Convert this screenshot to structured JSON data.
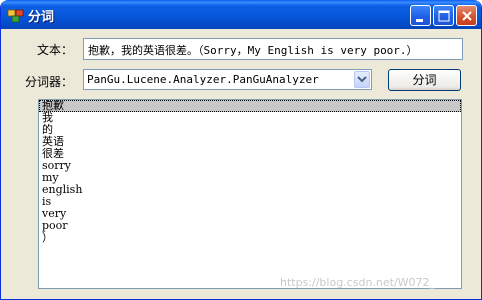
{
  "window": {
    "title": "分词"
  },
  "form": {
    "text_label": "文本：",
    "text_value": "抱歉，我的英语很差。（Sorry，My English is very poor.）",
    "segmenter_label": "分词器：",
    "segmenter_value": "PanGu.Lucene.Analyzer.PanGuAnalyzer",
    "segment_button": "分词"
  },
  "results": {
    "items": [
      "抱歉",
      "我",
      "的",
      "英语",
      "很差",
      "sorry",
      "my",
      "english",
      "is",
      "very",
      "poor",
      "）"
    ],
    "selected_index": 0
  },
  "watermark": "https://blog.csdn.net/W072_",
  "colors": {
    "titlebar": "#0756d8",
    "face": "#ece9d8",
    "border": "#7f9db9",
    "selection": "#c8c8c8"
  },
  "icons": {
    "app": "app-icon",
    "minimize": "minimize-icon",
    "maximize": "maximize-icon",
    "close": "close-icon",
    "dropdown": "chevron-down-icon"
  }
}
